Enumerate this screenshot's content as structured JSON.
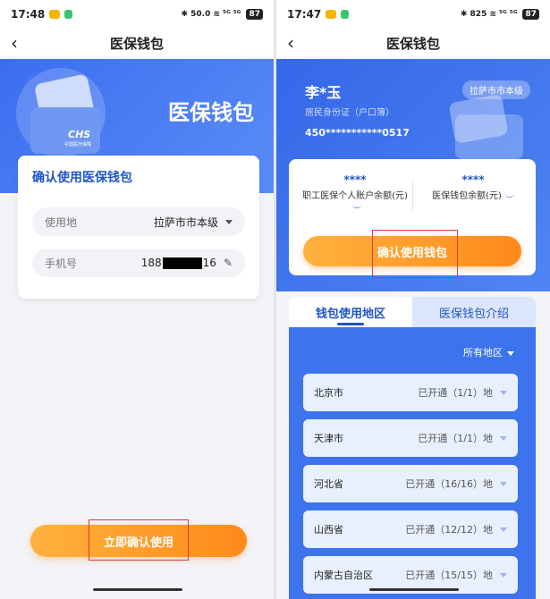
{
  "left": {
    "status": {
      "time": "17:48",
      "right": "✱ 50.0 ≋ ⁵ᴳ ⁵ᴳ",
      "battery": "87"
    },
    "nav_title": "医保钱包",
    "hero_title": "医保钱包",
    "card_logo": "CHS",
    "card_sub": "中国医疗保障",
    "confirm_title": "确认使用医保钱包",
    "location_label": "使用地",
    "location_value": "拉萨市市本级",
    "phone_label": "手机号",
    "phone_prefix": "188",
    "phone_suffix": "16",
    "submit_label": "立即确认使用"
  },
  "right": {
    "status": {
      "time": "17:47",
      "right": "✱ 825 ≋ ⁵ᴳ ⁵ᴳ",
      "battery": "87"
    },
    "nav_title": "医保钱包",
    "user_name": "李*玉",
    "id_type": "居民身份证（户口簿）",
    "id_number": "450***********0517",
    "region_pill": "拉萨市市本级",
    "balance1_stars": "****",
    "balance1_label": "职工医保个人账户余额(元)",
    "balance2_stars": "****",
    "balance2_label": "医保钱包余额(元)",
    "confirm_label": "确认使用钱包",
    "tab_active": "钱包使用地区",
    "tab_inactive": "医保钱包介绍",
    "filter_label": "所有地区",
    "regions": [
      {
        "name": "北京市",
        "status": "已开通（1/1）地"
      },
      {
        "name": "天津市",
        "status": "已开通（1/1）地"
      },
      {
        "name": "河北省",
        "status": "已开通（16/16）地"
      },
      {
        "name": "山西省",
        "status": "已开通（12/12）地"
      },
      {
        "name": "内蒙古自治区",
        "status": "已开通（15/15）地"
      }
    ]
  },
  "colors": {
    "primary_blue": "#3b6ef0",
    "accent_orange": "#ff8a1a",
    "highlight_red": "#e53935"
  }
}
